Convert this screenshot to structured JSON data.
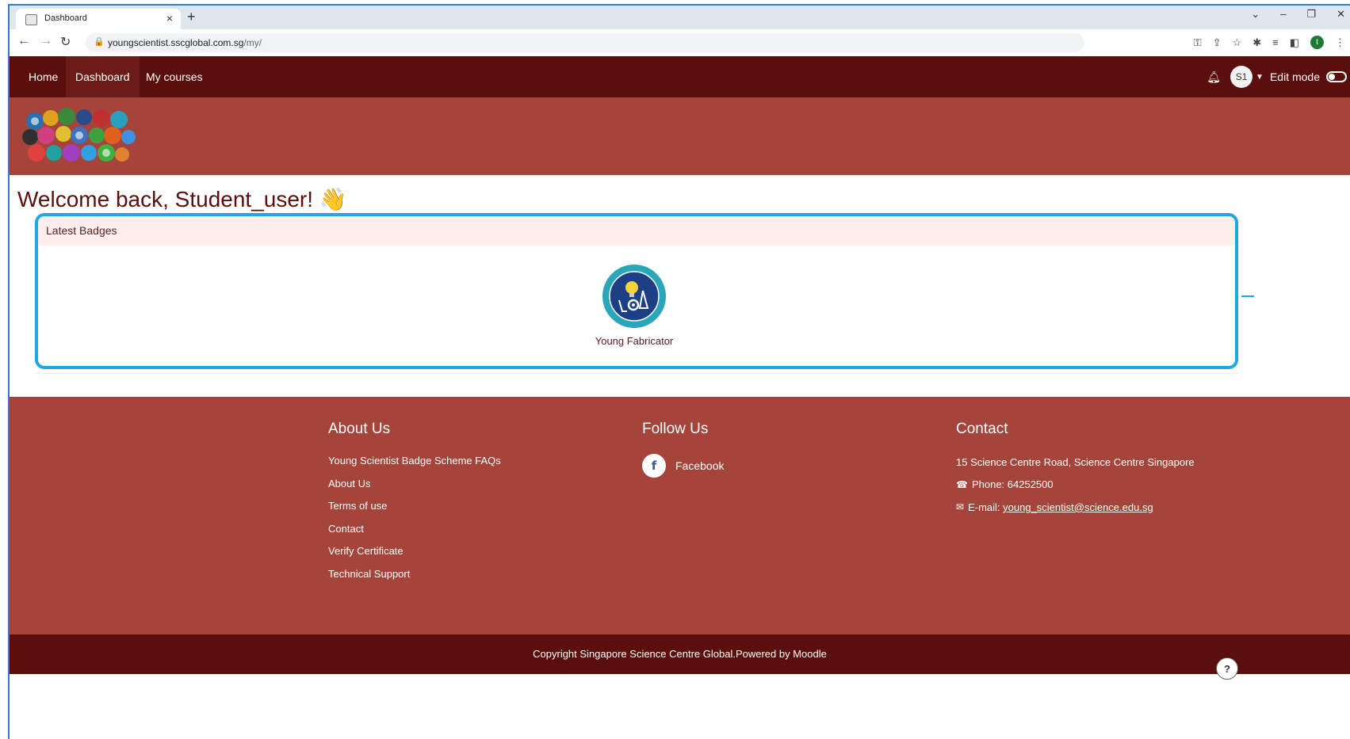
{
  "browser": {
    "tab_title": "Dashboard",
    "tab_close": "×",
    "new_tab": "+",
    "url_host": "youngscientist.sscglobal.com.sg",
    "url_path": "/my/",
    "window_controls": [
      "⌄",
      "–",
      "❐",
      "✕"
    ],
    "profile_initial": "t"
  },
  "nav": {
    "items": [
      {
        "label": "Home",
        "active": false
      },
      {
        "label": "Dashboard",
        "active": true
      },
      {
        "label": "My courses",
        "active": false
      }
    ],
    "avatar_initials": "S1",
    "edit_mode_label": "Edit mode"
  },
  "page": {
    "welcome": "Welcome back, Student_user! 👋"
  },
  "badges": {
    "title": "Latest Badges",
    "items": [
      {
        "name": "Young Fabricator"
      }
    ]
  },
  "footer": {
    "about": {
      "heading": "About Us",
      "links": [
        "Young Scientist Badge Scheme FAQs",
        "About Us",
        "Terms of use",
        "Contact",
        "Verify Certificate",
        "Technical Support"
      ]
    },
    "follow": {
      "heading": "Follow Us",
      "facebook_label": "Facebook"
    },
    "contact": {
      "heading": "Contact",
      "address": "15 Science Centre Road, Science Centre Singapore",
      "phone": "Phone: 64252500",
      "email_prefix": "E-mail:",
      "email": "young_scientist@science.edu.sg"
    },
    "copyright": "Copyright Singapore Science Centre Global.Powered by Moodle"
  },
  "colors": {
    "nav_bg": "#5a0f0c",
    "header_bg": "#a5443a",
    "highlight_border": "#1fa8e0",
    "badges_header_bg": "#fdeeee"
  }
}
